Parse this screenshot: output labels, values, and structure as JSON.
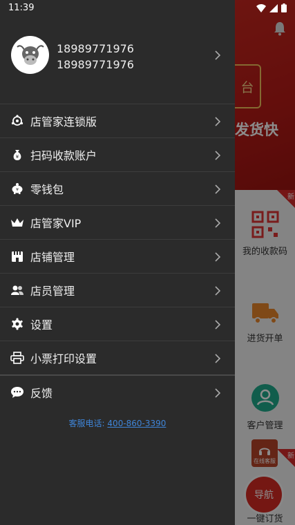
{
  "status_bar": {
    "time": "11:39"
  },
  "profile": {
    "line1": "18989771976",
    "line2": "18989771976"
  },
  "menu": [
    {
      "label": "店管家连锁版",
      "icon": "chain-store-icon"
    },
    {
      "label": "扫码收款账户",
      "icon": "money-bag-icon"
    },
    {
      "label": "零钱包",
      "icon": "piggy-bank-icon"
    },
    {
      "label": "店管家VIP",
      "icon": "crown-icon"
    },
    {
      "label": "店铺管理",
      "icon": "storefront-icon"
    },
    {
      "label": "店员管理",
      "icon": "staff-icon"
    },
    {
      "label": "设置",
      "icon": "gear-icon"
    },
    {
      "label": "小票打印设置",
      "icon": "printer-icon"
    },
    {
      "label": "反馈",
      "icon": "chat-bubble-icon"
    }
  ],
  "hotline": {
    "label": "客服电话:",
    "number": "400-860-3390"
  },
  "background": {
    "hero_badge": "台",
    "hero_text": "发货快",
    "items": [
      "我的收款码",
      "进货开单",
      "客户管理",
      "一键订货"
    ],
    "new_tag": "新",
    "service_label": "在线客服",
    "nav_button": "导航"
  },
  "colors": {
    "drawer_bg": "#2b2b2b",
    "accent_red": "#c7271f",
    "link_blue": "#3f85d8"
  }
}
